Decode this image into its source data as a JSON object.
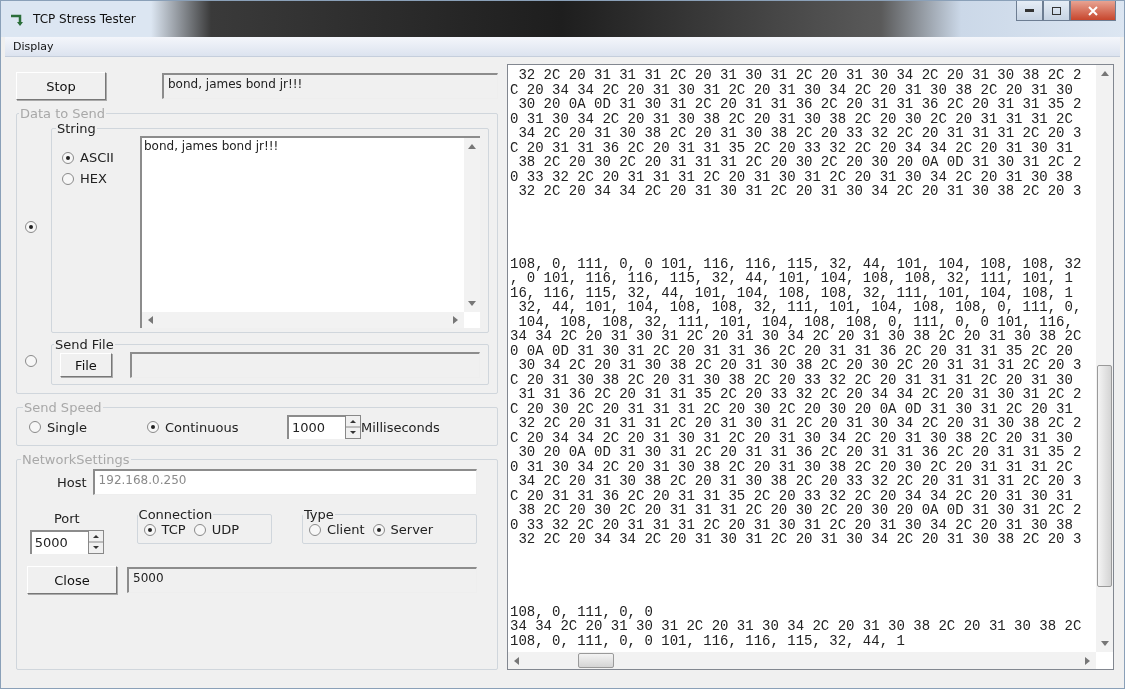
{
  "window": {
    "title": "TCP Stress Tester"
  },
  "menu": [
    {
      "label": "Display"
    }
  ],
  "stop_button": "Stop",
  "status_field": {
    "value": "bond, james bond jr!!!"
  },
  "data_to_send": {
    "title": "Data to Send",
    "disabled": true,
    "sources": [
      {
        "kind": "string",
        "selected": true,
        "title": "String",
        "encodings": [
          {
            "label": "ASCII",
            "selected": true
          },
          {
            "label": "HEX",
            "selected": false
          }
        ],
        "value": "bond, james bond jr!!!"
      },
      {
        "kind": "file",
        "selected": false,
        "title": "Send File",
        "button": "File"
      }
    ]
  },
  "send_speed": {
    "title": "Send Speed",
    "disabled": true,
    "modes": [
      {
        "label": "Single",
        "selected": false
      },
      {
        "label": "Continuous",
        "selected": true
      }
    ],
    "interval": "1000",
    "unit": "Milliseconds"
  },
  "network": {
    "title": "NetworkSettings",
    "disabled": true,
    "host_label": "Host",
    "host": {
      "value": "192.168.0.250",
      "disabled": true
    },
    "port_label": "Port",
    "port": "5000",
    "connection": {
      "title": "Connection",
      "options": [
        {
          "label": "TCP",
          "selected": true
        },
        {
          "label": "UDP",
          "selected": false
        }
      ]
    },
    "type": {
      "title": "Type",
      "options": [
        {
          "label": "Client",
          "selected": false
        },
        {
          "label": "Server",
          "selected": true
        }
      ]
    },
    "close_button": "Close",
    "status_field": "5000"
  },
  "output": {
    "blocks": [
      [
        " 32 2C 20 31 31 31 2C 20 31 30 31 2C 20 31 30 34 2C 20 31 30 38 2C 2",
        "C 20 34 34 2C 20 31 30 31 2C 20 31 30 34 2C 20 31 30 38 2C 20 31 30",
        " 30 20 0A 0D 31 30 31 2C 20 31 31 36 2C 20 31 31 36 2C 20 31 31 35 2",
        "0 31 30 34 2C 20 31 30 38 2C 20 31 30 38 2C 20 30 2C 20 31 31 31 2C",
        " 34 2C 20 31 30 38 2C 20 31 30 38 2C 20 33 32 2C 20 31 31 31 2C 20 3",
        "C 20 31 31 36 2C 20 31 31 35 2C 20 33 32 2C 20 34 34 2C 20 31 30 31",
        " 38 2C 20 30 2C 20 31 31 31 2C 20 30 2C 20 30 20 0A 0D 31 30 31 2C 2",
        "0 33 32 2C 20 31 31 31 2C 20 31 30 31 2C 20 31 30 34 2C 20 31 30 38",
        " 32 2C 20 34 34 2C 20 31 30 31 2C 20 31 30 34 2C 20 31 30 38 2C 20 3"
      ],
      [
        "108, 0, 111, 0, 0 101, 116, 116, 115, 32, 44, 101, 104, 108, 108, 32",
        ", 0 101, 116, 116, 115, 32, 44, 101, 104, 108, 108, 32, 111, 101, 1",
        "16, 116, 115, 32, 44, 101, 104, 108, 108, 32, 111, 101, 104, 108, 1",
        " 32, 44, 101, 104, 108, 108, 32, 111, 101, 104, 108, 108, 0, 111, 0,",
        " 104, 108, 108, 32, 111, 101, 104, 108, 108, 0, 111, 0, 0 101, 116,",
        "34 34 2C 20 31 30 31 2C 20 31 30 34 2C 20 31 30 38 2C 20 31 30 38 2C",
        "0 0A 0D 31 30 31 2C 20 31 31 36 2C 20 31 31 36 2C 20 31 31 35 2C 20",
        " 30 34 2C 20 31 30 38 2C 20 31 30 38 2C 20 30 2C 20 31 31 31 2C 20 3",
        "C 20 31 30 38 2C 20 31 30 38 2C 20 33 32 2C 20 31 31 31 2C 20 31 30",
        " 31 31 36 2C 20 31 31 35 2C 20 33 32 2C 20 34 34 2C 20 31 30 31 2C 2",
        "C 20 30 2C 20 31 31 31 2C 20 30 2C 20 30 20 0A 0D 31 30 31 2C 20 31",
        " 32 2C 20 31 31 31 2C 20 31 30 31 2C 20 31 30 34 2C 20 31 30 38 2C 2",
        "C 20 34 34 2C 20 31 30 31 2C 20 31 30 34 2C 20 31 30 38 2C 20 31 30",
        " 30 20 0A 0D 31 30 31 2C 20 31 31 36 2C 20 31 31 36 2C 20 31 31 35 2",
        "0 31 30 34 2C 20 31 30 38 2C 20 31 30 38 2C 20 30 2C 20 31 31 31 2C",
        " 34 2C 20 31 30 38 2C 20 31 30 38 2C 20 33 32 2C 20 31 31 31 2C 20 3",
        "C 20 31 31 36 2C 20 31 31 35 2C 20 33 32 2C 20 34 34 2C 20 31 30 31",
        " 38 2C 20 30 2C 20 31 31 31 2C 20 30 2C 20 30 20 0A 0D 31 30 31 2C 2",
        "0 33 32 2C 20 31 31 31 2C 20 31 30 31 2C 20 31 30 34 2C 20 31 30 38",
        " 32 2C 20 34 34 2C 20 31 30 31 2C 20 31 30 34 2C 20 31 30 38 2C 20 3"
      ],
      [
        "108, 0, 111, 0, 0",
        "34 34 2C 20 31 30 31 2C 20 31 30 34 2C 20 31 30 38 2C 20 31 30 38 2C",
        "108, 0, 111, 0, 0 101, 116, 116, 115, 32, 44, 1"
      ]
    ]
  }
}
